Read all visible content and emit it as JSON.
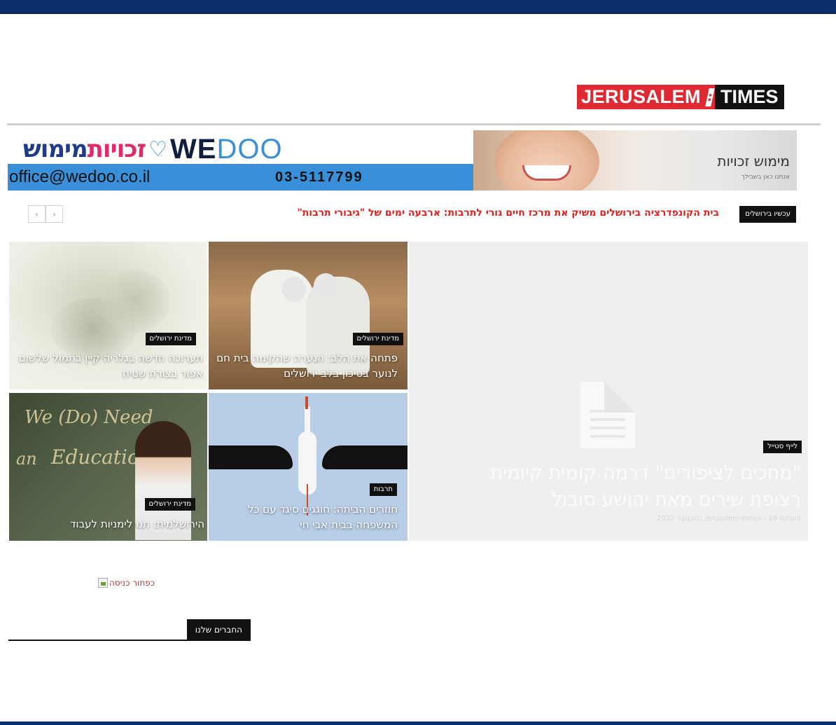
{
  "logo": {
    "part1": "JERUSALEM",
    "separator": ":",
    "part2": "TIMES"
  },
  "banner": {
    "heb_brand_1": "מימוש",
    "heb_brand_2": "זכויות",
    "brand_en_bold": "WE",
    "brand_en_light": "DOO",
    "email": "office@wedoo.co.il",
    "phone": "03-5117799",
    "right_title": "מימוש זכויות",
    "right_sub": "אנחנו כאן בשבילך"
  },
  "ticker": {
    "label": "עכשיו בירושלים",
    "text": "בית הקונפדרציה בירושלים משיק את מרכז חיים גורי לתרבות: ארבעה ימים של \"גיבורי תרבות\"",
    "prev_icon": "chevron-left-icon",
    "next_icon": "chevron-right-icon",
    "prev_glyph": "‹",
    "next_glyph": "›"
  },
  "tiles": {
    "main": {
      "category": "לייף סטייל",
      "title": "\"מחכים לציפורים\" דרמה קומית קיומית רצופת שירים מאת יהושע סובול",
      "meta": "מערכת jerusalem-times - 16 בנובמבר 2022"
    },
    "boys": {
      "category": "מדינת ירושלים",
      "title": "פתחה את הלב: הנערה שהקימה בית חם לנוער בסיכון בלב ירושלים"
    },
    "smoke": {
      "category": "מדינת ירושלים",
      "title": "תערוכה חדשה בגלריה קיין בתמול שלשום אפור בצורת שטיח"
    },
    "stork": {
      "category": "תרבות",
      "title": "חוזרים הביתה: חוגגים סיגד עם כל המשפחה בבית אבי חי"
    },
    "board": {
      "category": "מדינת ירושלים",
      "title": "הירושלמית: תנו לימניות לעבוד"
    }
  },
  "login": {
    "alt_text": "כפתור כניסה"
  },
  "friends": {
    "label": "החברים שלנו"
  },
  "colors": {
    "brand_red": "#e02a33",
    "navy": "#0d2f6b",
    "ticker_red": "#e0201d"
  }
}
